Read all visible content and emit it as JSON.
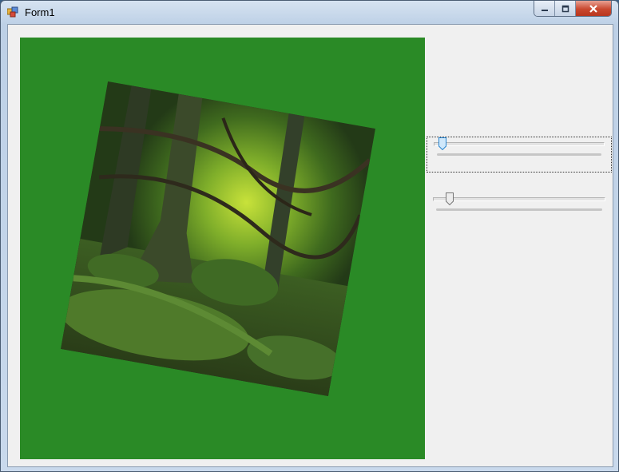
{
  "window": {
    "title": "Form1",
    "controls": [
      "minimize",
      "maximize",
      "close"
    ]
  },
  "trackbar1": {
    "value_fraction": 0.03
  },
  "trackbar2": {
    "value_fraction": 0.08
  },
  "colors": {
    "picture_background": "#2a8a26",
    "client_background": "#f0f0f0"
  }
}
